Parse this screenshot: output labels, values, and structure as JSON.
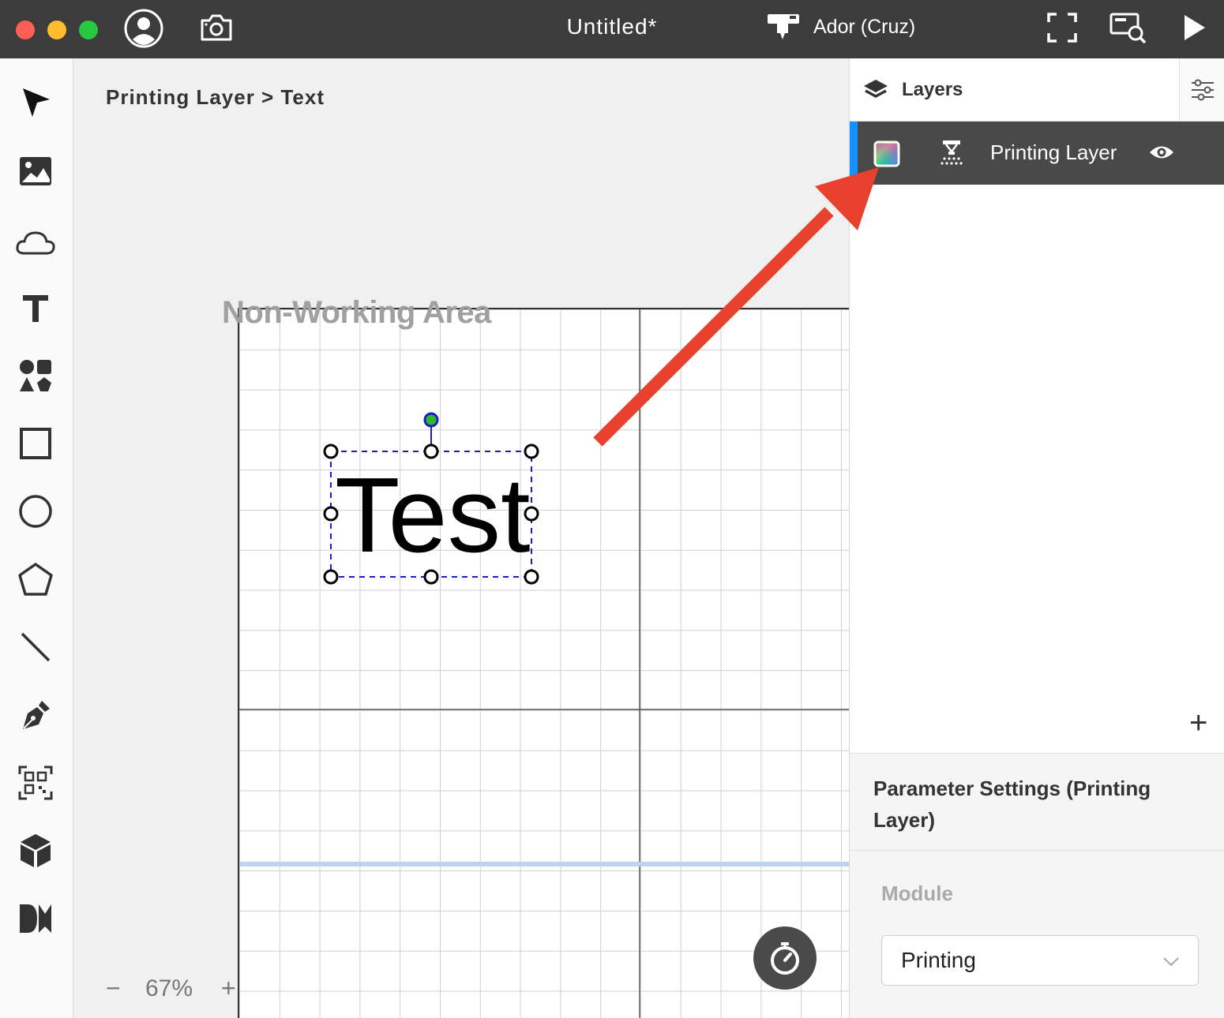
{
  "window": {
    "title": "Untitled*"
  },
  "device": {
    "name": "Ador (Cruz)"
  },
  "canvas": {
    "breadcrumb": "Printing Layer > Text",
    "non_working_label": "Non-Working Area",
    "text_object": "Test",
    "zoom": {
      "minus": "−",
      "level": "67%",
      "plus": "+"
    }
  },
  "layers": {
    "title": "Layers",
    "items": [
      {
        "name": "Printing Layer"
      }
    ],
    "add_label": "+"
  },
  "parameters": {
    "title": "Parameter Settings (Printing Layer)",
    "module_label": "Module",
    "module_value": "Printing"
  },
  "colors": {
    "titlebar": "#3c3c3c",
    "selected_layer": "#494949",
    "accent": "#1890ff",
    "annotation_arrow": "#e8412e"
  }
}
